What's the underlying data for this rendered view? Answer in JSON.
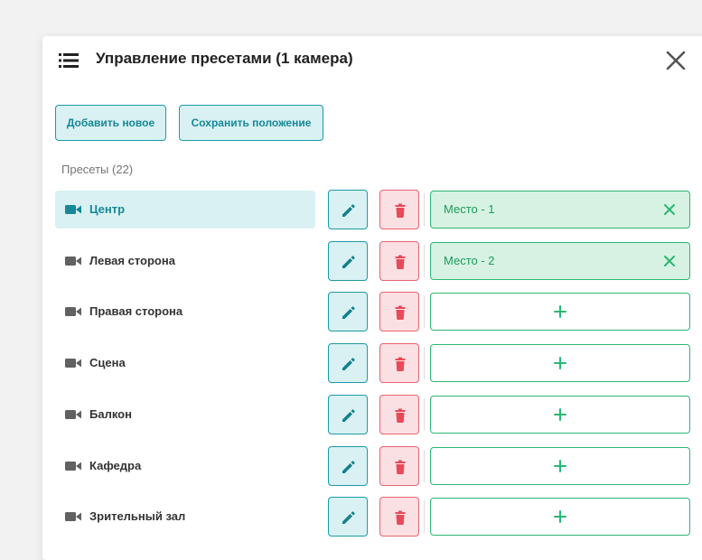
{
  "header": {
    "title": "Управление пресетами (1 камера)",
    "menu_icon": "list-icon",
    "close_icon": "close-icon"
  },
  "toolbar": {
    "add_label": "Добавить новое",
    "save_label": "Сохранить положение"
  },
  "presets_label": "Пресеты (22)",
  "colors": {
    "accent": "#1d9aa6",
    "accent_bg": "#d9f1f3",
    "danger": "#e84a5a",
    "danger_bg": "#fbe0e3",
    "success": "#2bb673",
    "success_bg": "#d7f2e2"
  },
  "presets": [
    {
      "name": "Центр",
      "active": true,
      "slot": "Место - 1"
    },
    {
      "name": "Левая сторона",
      "active": false,
      "slot": "Место - 2"
    },
    {
      "name": "Правая сторона",
      "active": false,
      "slot": null
    },
    {
      "name": "Сцена",
      "active": false,
      "slot": null
    },
    {
      "name": "Балкон",
      "active": false,
      "slot": null
    },
    {
      "name": "Кафедра",
      "active": false,
      "slot": null
    },
    {
      "name": "Зрительный зал",
      "active": false,
      "slot": null
    }
  ]
}
